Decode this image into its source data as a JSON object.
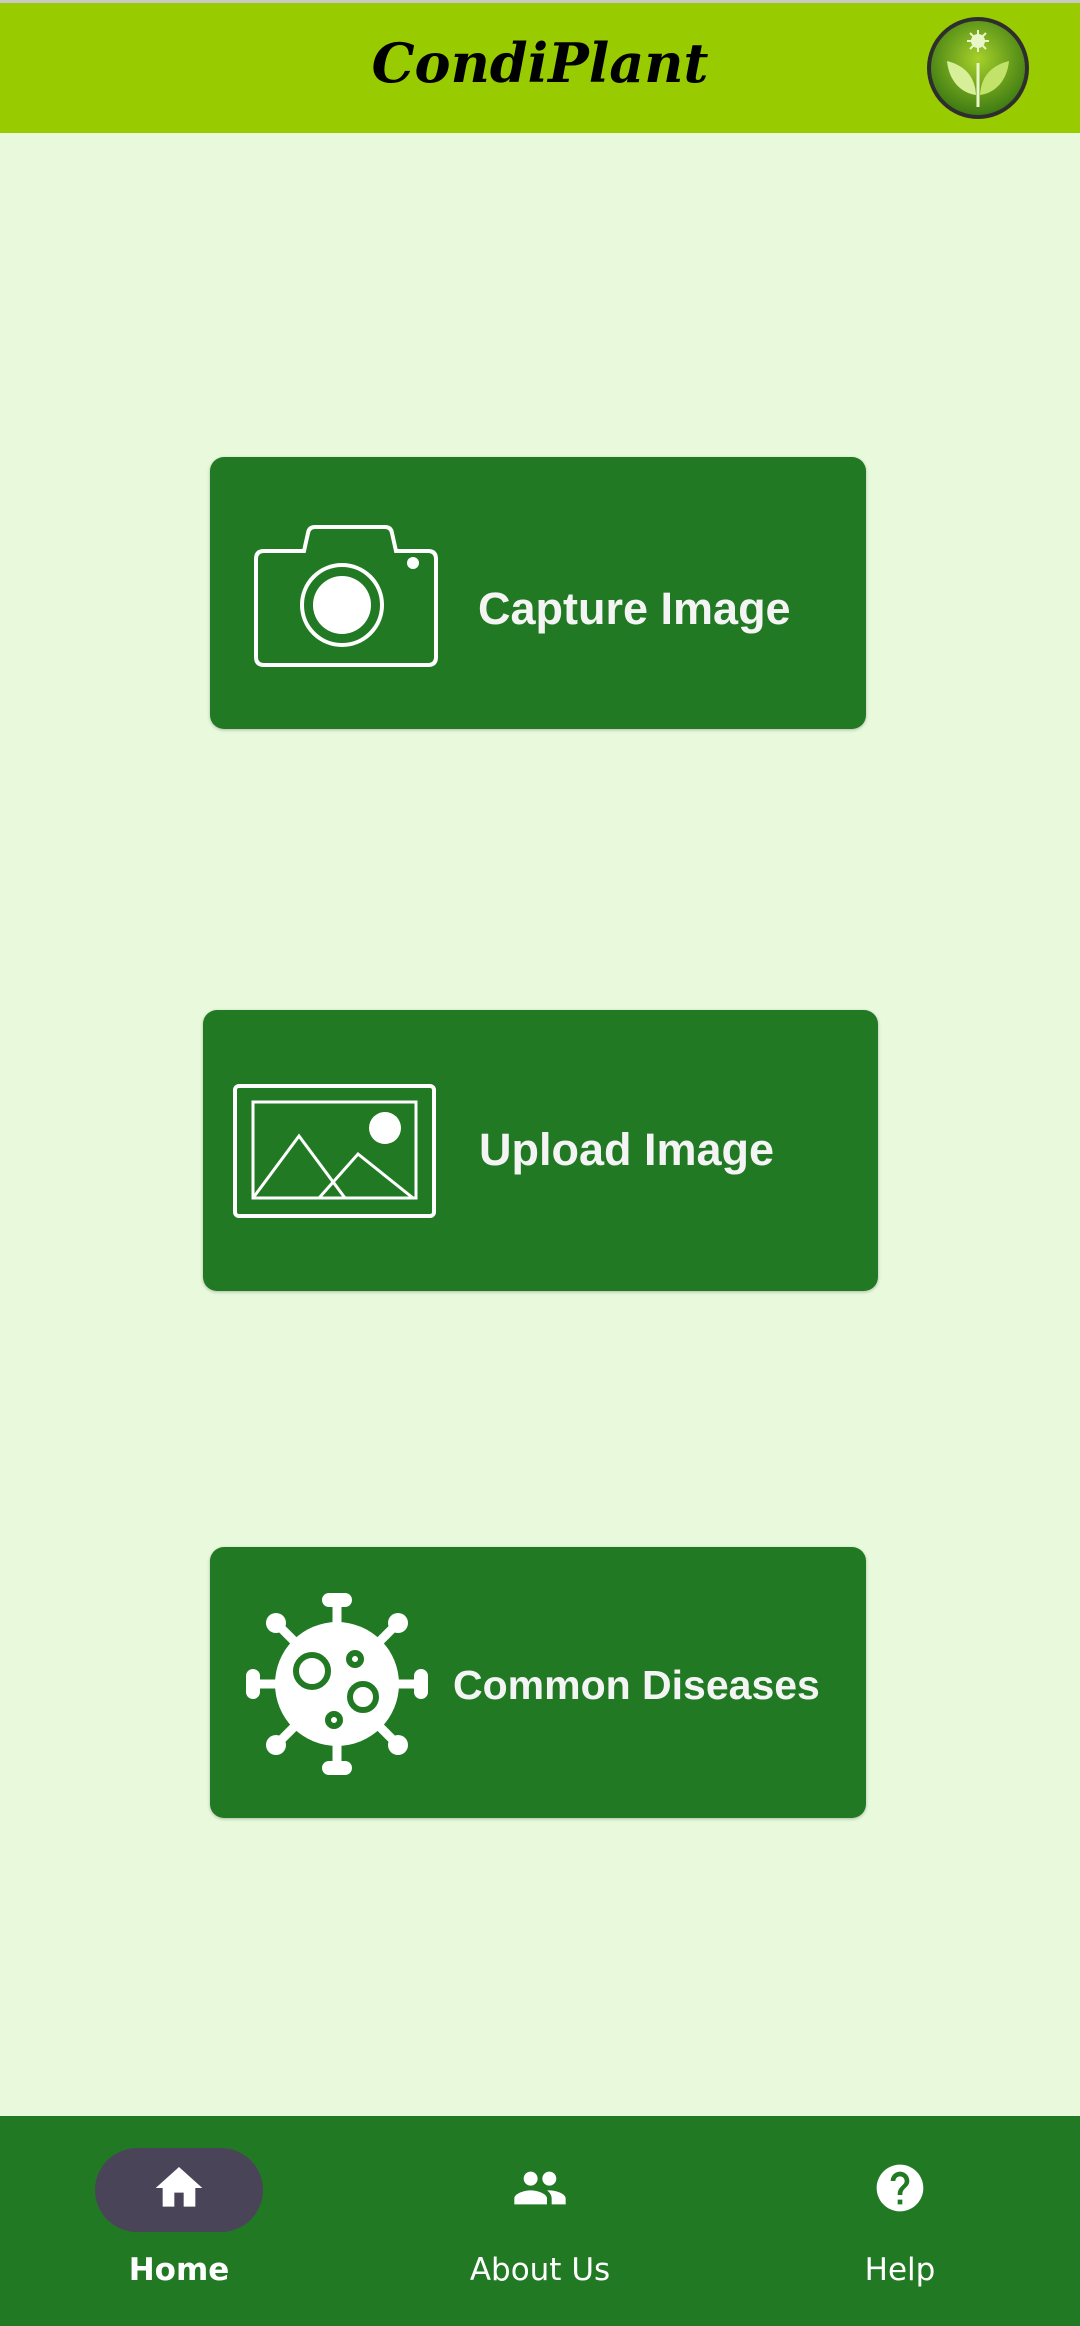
{
  "app": {
    "title": "CondiPlant",
    "colors": {
      "app_bar": "#99cc00",
      "background": "#e8f9dc",
      "button": "#217a23",
      "nav_bar": "#217a23",
      "nav_active_pill": "#4a4458"
    }
  },
  "actions": {
    "capture": {
      "label": "Capture Image",
      "icon": "camera-icon"
    },
    "upload": {
      "label": "Upload Image",
      "icon": "image-icon"
    },
    "diseases": {
      "label": "Common Diseases",
      "icon": "virus-icon"
    }
  },
  "nav": {
    "items": [
      {
        "label": "Home",
        "icon": "home-icon",
        "active": true
      },
      {
        "label": "About Us",
        "icon": "people-icon",
        "active": false
      },
      {
        "label": "Help",
        "icon": "help-icon",
        "active": false
      }
    ]
  }
}
